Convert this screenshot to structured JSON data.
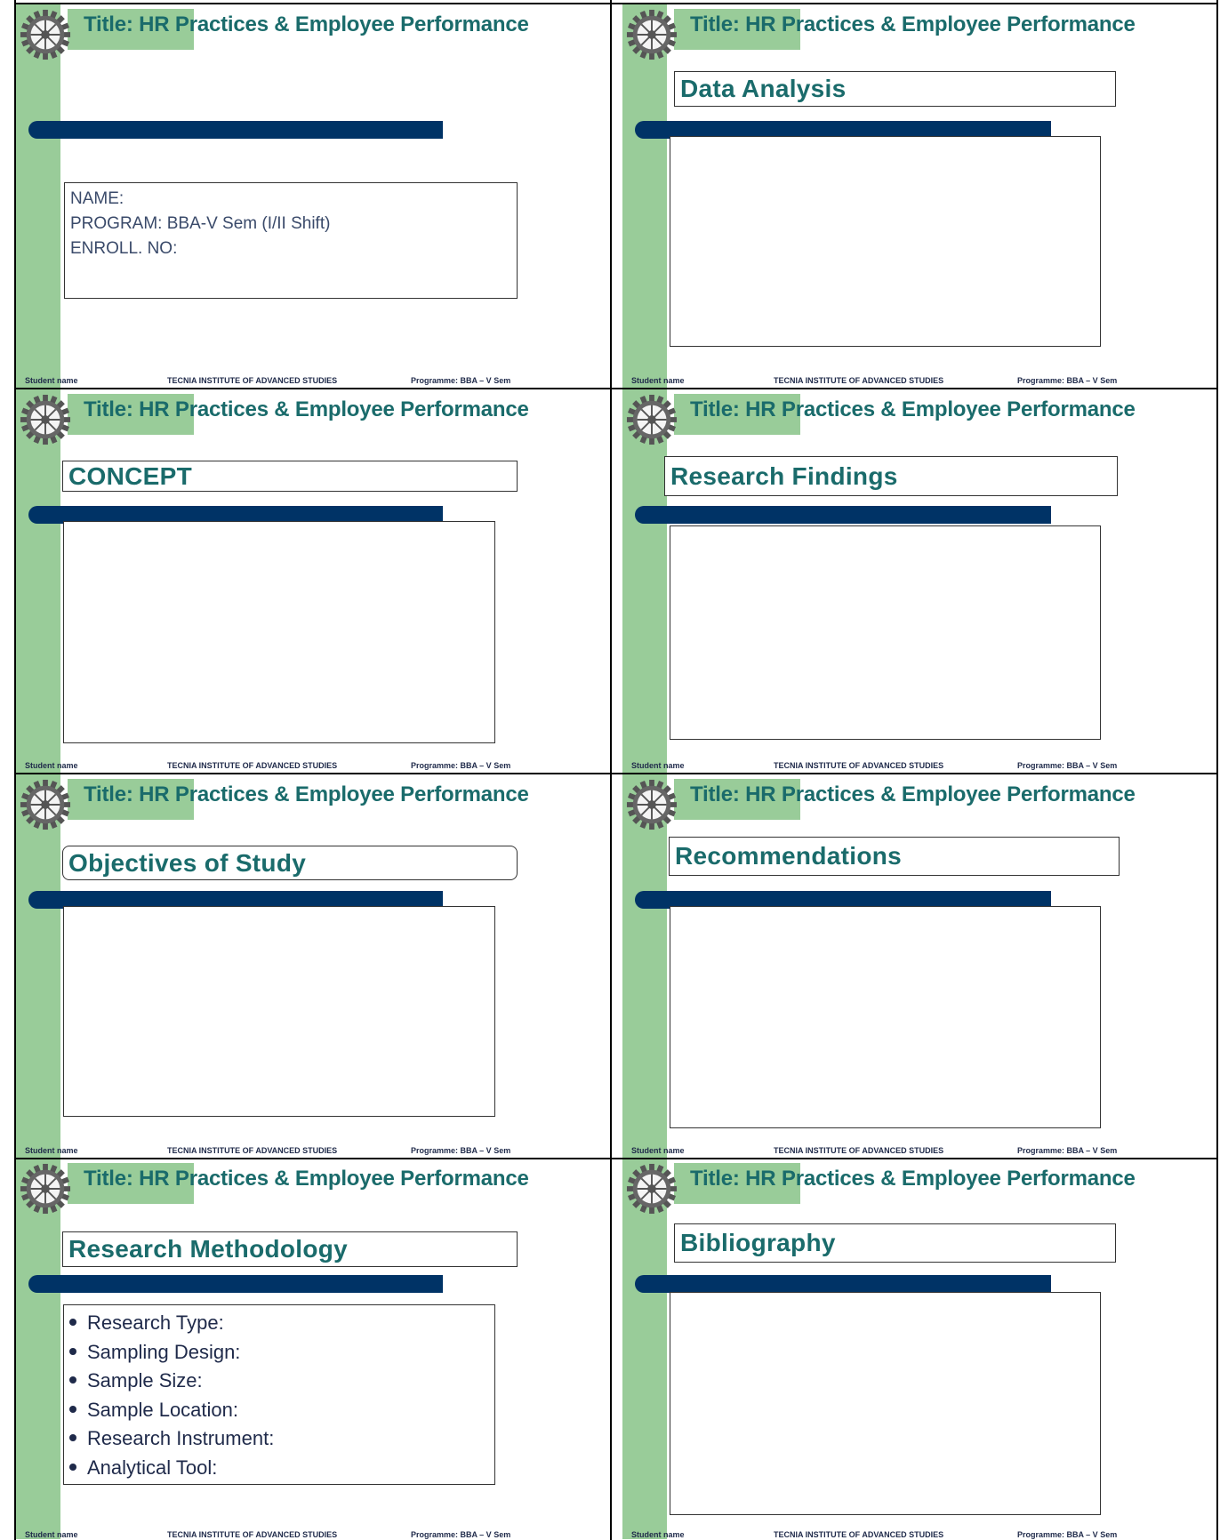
{
  "header_title": "Title: HR Practices & Employee Performance",
  "footer": {
    "student": "Student name",
    "institute": "TECNIA INSTITUTE OF ADVANCED STUDIES",
    "programme": "Programme: BBA – V Sem"
  },
  "logo_icon": "gear-wheel-logo-icon",
  "colors": {
    "green_strip": "#99cc99",
    "title_text": "#1a6b6b",
    "bar": "#003366",
    "body_text": "#3a4a6a"
  },
  "slides": [
    {
      "heading": "",
      "info_lines": [
        "NAME:",
        "PROGRAM: BBA-V Sem (I/II Shift)",
        "ENROLL. NO:"
      ]
    },
    {
      "heading": "Data Analysis"
    },
    {
      "heading": "CONCEPT"
    },
    {
      "heading": "Research Findings"
    },
    {
      "heading": "Objectives of Study"
    },
    {
      "heading": "Recommendations"
    },
    {
      "heading": "Research Methodology",
      "bullets": [
        "Research Type:",
        "Sampling Design:",
        "Sample Size:",
        "Sample Location:",
        "Research Instrument:",
        "Analytical Tool:"
      ]
    },
    {
      "heading": "Bibliography"
    }
  ]
}
